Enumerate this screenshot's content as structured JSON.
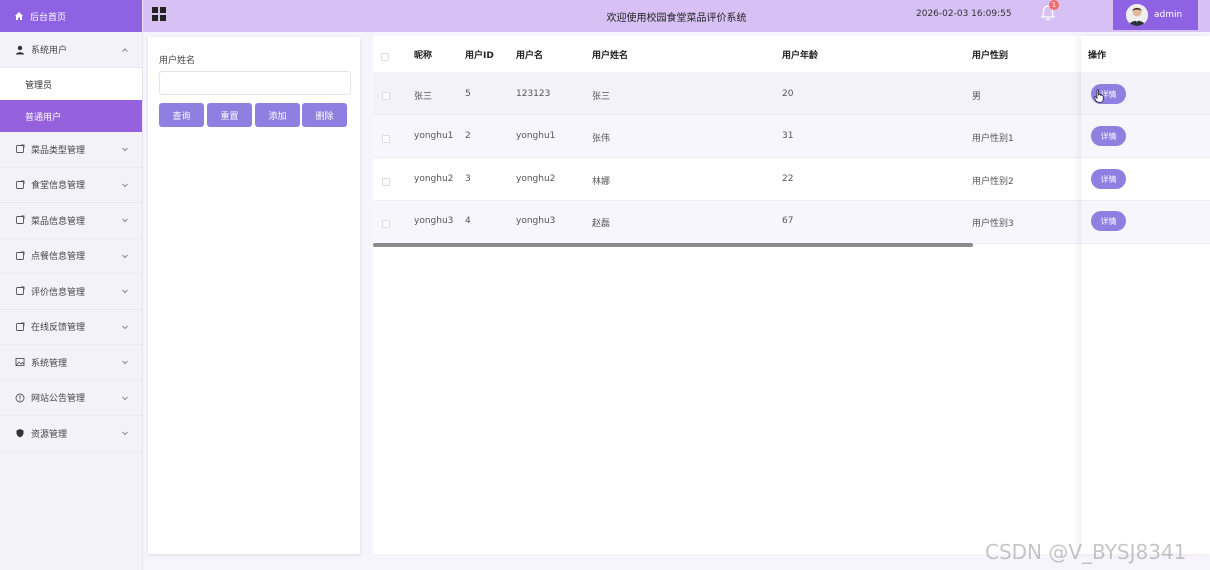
{
  "header": {
    "title": "欢迎使用校园食堂菜品评价系统",
    "datetime": "2026-02-03 16:09:55",
    "notification_count": "1",
    "username": "admin"
  },
  "sidebar": {
    "home": "后台首页",
    "items": [
      {
        "label": "系统用户",
        "icon": "user-icon",
        "expanded": true,
        "children": [
          {
            "label": "管理员",
            "active": false
          },
          {
            "label": "普通用户",
            "active": true
          }
        ]
      },
      {
        "label": "菜品类型管理",
        "icon": "document-icon"
      },
      {
        "label": "食堂信息管理",
        "icon": "document-icon"
      },
      {
        "label": "菜品信息管理",
        "icon": "document-icon"
      },
      {
        "label": "点餐信息管理",
        "icon": "document-icon"
      },
      {
        "label": "评价信息管理",
        "icon": "document-icon"
      },
      {
        "label": "在线反馈管理",
        "icon": "document-icon"
      },
      {
        "label": "系统管理",
        "icon": "image-icon"
      },
      {
        "label": "网站公告管理",
        "icon": "info-circle-icon"
      },
      {
        "label": "资源管理",
        "icon": "shield-icon"
      }
    ]
  },
  "search": {
    "label": "用户姓名",
    "value": "",
    "buttons": {
      "query": "查询",
      "reset": "重置",
      "add": "添加",
      "delete": "删除"
    }
  },
  "table": {
    "columns": {
      "nickname": "昵称",
      "user_id": "用户ID",
      "username": "用户名",
      "real_name": "用户姓名",
      "age": "用户年龄",
      "gender": "用户性别",
      "action": "操作"
    },
    "rows": [
      {
        "nickname": "张三",
        "user_id": "5",
        "username": "123123",
        "real_name": "张三",
        "age": "20",
        "gender": "男",
        "action": "详情"
      },
      {
        "nickname": "yonghu1",
        "user_id": "2",
        "username": "yonghu1",
        "real_name": "张伟",
        "age": "31",
        "gender": "用户性别1",
        "action": "详情"
      },
      {
        "nickname": "yonghu2",
        "user_id": "3",
        "username": "yonghu2",
        "real_name": "林娜",
        "age": "22",
        "gender": "用户性别2",
        "action": "详情"
      },
      {
        "nickname": "yonghu3",
        "user_id": "4",
        "username": "yonghu3",
        "real_name": "赵磊",
        "age": "67",
        "gender": "用户性别3",
        "action": "详情"
      }
    ]
  },
  "colors": {
    "primary": "#8f62e3",
    "header_bg": "#d7c0f4",
    "button": "#8e7fe0",
    "active_menu": "#9561dc"
  },
  "watermark": "CSDN @V_BYSJ8341"
}
